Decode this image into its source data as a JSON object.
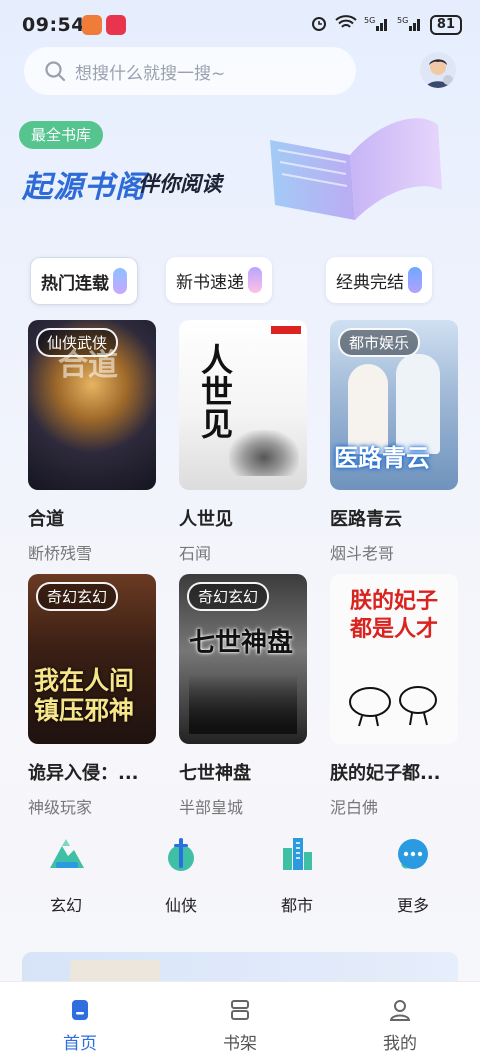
{
  "status": {
    "time": "09:54",
    "signal1": "5G",
    "signal2": "5G",
    "battery": "81"
  },
  "search": {
    "placeholder": "想搜什么就搜一搜~"
  },
  "banner": {
    "tag": "最全书库",
    "brand": "起源书阁",
    "slogan": "伴你阅读"
  },
  "chips": [
    {
      "label": "热门连载"
    },
    {
      "label": "新书速递"
    },
    {
      "label": "经典完结"
    }
  ],
  "books": [
    {
      "title": "合道",
      "author": "断桥残雪",
      "tag": "仙侠武侠",
      "cover_text": "合道"
    },
    {
      "title": "人世见",
      "author": "石闻",
      "tag": "",
      "cover_text": "人世见"
    },
    {
      "title": "医路青云",
      "author": "烟斗老哥",
      "tag": "都市娱乐",
      "cover_text": "医路青云"
    },
    {
      "title": "诡异入侵：...",
      "author": "神级玩家",
      "tag": "奇幻玄幻",
      "cover_text": "我在人间镇压邪神"
    },
    {
      "title": "七世神盘",
      "author": "半部皇城",
      "tag": "奇幻玄幻",
      "cover_text": "七世神盘"
    },
    {
      "title": "朕的妃子都...",
      "author": "泥白佛",
      "tag": "",
      "cover_text": "朕的妃子都是人才"
    }
  ],
  "genres": [
    {
      "label": "玄幻",
      "icon": "mountain-icon"
    },
    {
      "label": "仙侠",
      "icon": "sword-icon"
    },
    {
      "label": "都市",
      "icon": "city-icon"
    },
    {
      "label": "更多",
      "icon": "more-icon"
    }
  ],
  "tabs": [
    {
      "label": "首页",
      "icon": "home-icon"
    },
    {
      "label": "书架",
      "icon": "bookshelf-icon"
    },
    {
      "label": "我的",
      "icon": "profile-icon"
    }
  ],
  "colors": {
    "accent": "#2f6ee0",
    "tag_green": "#55c48f",
    "brand_blue": "#2d6bd6"
  }
}
